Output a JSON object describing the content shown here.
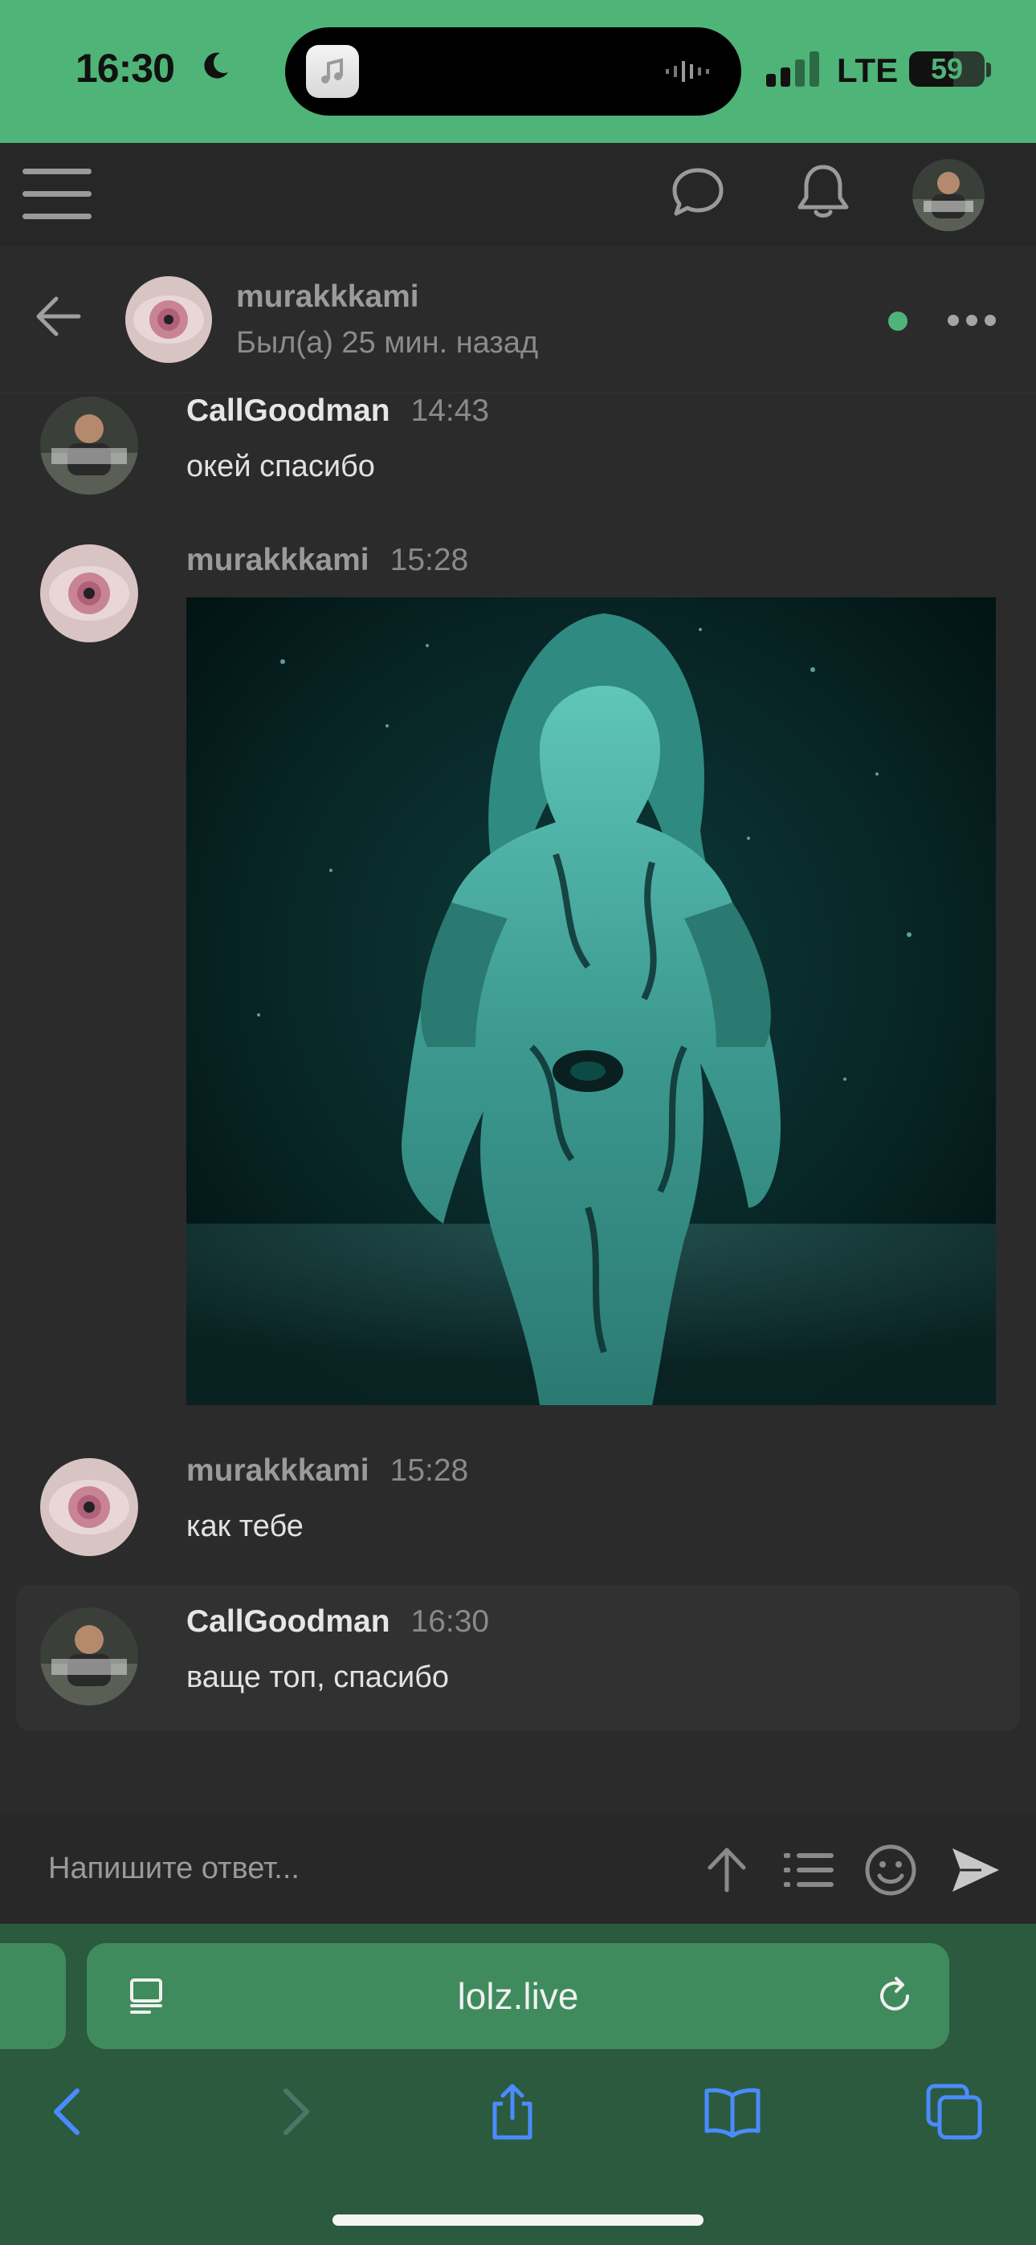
{
  "status_bar": {
    "time": "16:30",
    "network": "LTE",
    "battery_level": "59",
    "battery_fraction": 0.59,
    "icons": [
      "moon-icon",
      "music-app-icon",
      "audio-wave-icon",
      "signal-icon",
      "battery-icon"
    ]
  },
  "app_header": {
    "icons": [
      "hamburger-icon",
      "chat-bubble-icon",
      "bell-icon",
      "avatar"
    ]
  },
  "conversation": {
    "name": "murakkkami",
    "status": "Был(а) 25 мин. назад",
    "online_color": "#4fb477"
  },
  "messages": [
    {
      "author": "CallGoodman",
      "time": "14:43",
      "text": "окей спасибо"
    },
    {
      "author": "murakkkami",
      "time": "15:28",
      "text": ""
    },
    {
      "author": "murakkkami",
      "time": "15:28",
      "text": "как тебе"
    },
    {
      "author": "CallGoodman",
      "time": "16:30",
      "text": "ваще топ, спасибо"
    }
  ],
  "reply": {
    "placeholder": "Напишите ответ...",
    "icons": [
      "upload-arrow-icon",
      "list-icon",
      "smiley-icon",
      "send-icon"
    ]
  },
  "browser": {
    "url": "lolz.live",
    "icons": [
      "reader-icon",
      "reload-icon",
      "back-icon",
      "forward-icon",
      "share-icon",
      "bookmarks-icon",
      "tabs-icon"
    ]
  },
  "colors": {
    "accent": "#4fb477",
    "background": "#2b2b2b",
    "safari_bar": "#2b5a3f"
  }
}
